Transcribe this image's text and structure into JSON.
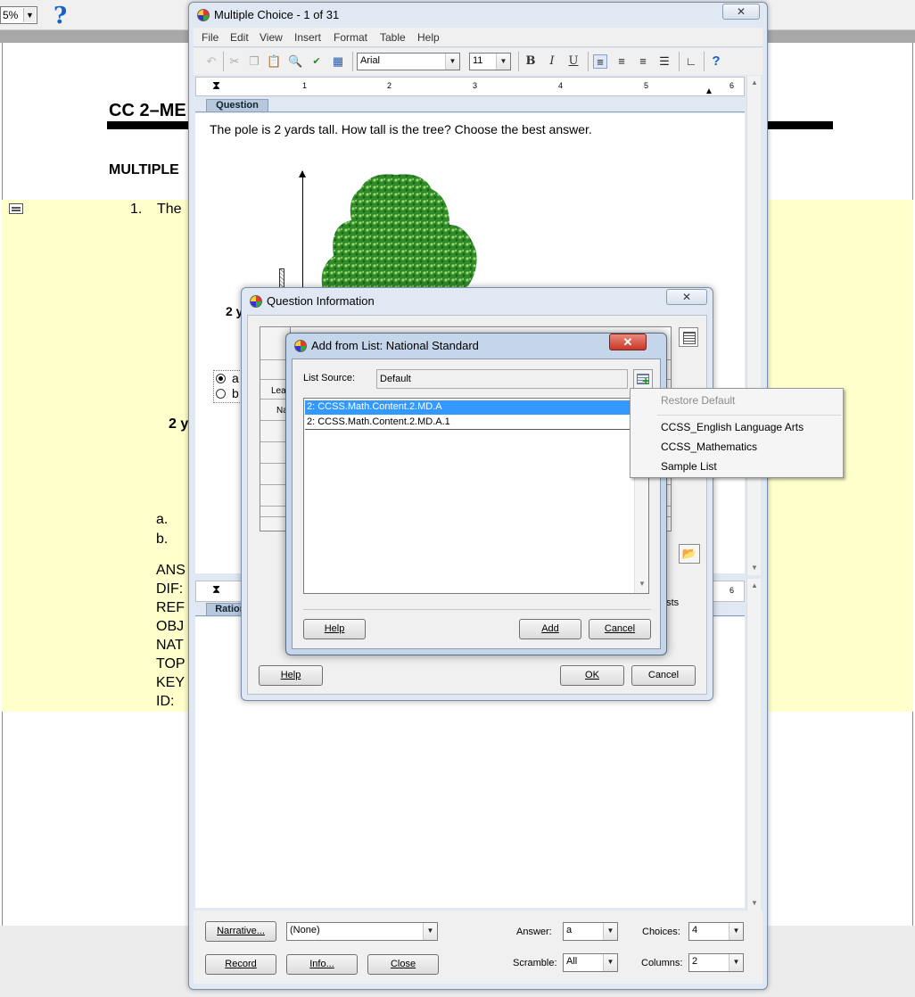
{
  "background_doc": {
    "zoom_value": "5%",
    "title": "CC 2–ME",
    "section_heading": "MULTIPLE",
    "question_number": "1.",
    "question_start": "The",
    "answer_lines": [
      "a.",
      "b."
    ],
    "field_lines": [
      "ANS",
      "DIF:",
      "REF",
      "OBJ",
      "NAT",
      "TOP",
      "KEY",
      "ID:"
    ]
  },
  "mc_window": {
    "title": "Multiple Choice - 1 of 31",
    "close_glyph": "✕",
    "menu": [
      "File",
      "Edit",
      "View",
      "Insert",
      "Format",
      "Table",
      "Help"
    ],
    "font_name": "Arial",
    "font_size": "11",
    "ruler_numbers": [
      "1",
      "2",
      "3",
      "4",
      "5",
      "6"
    ],
    "section_question": "Question",
    "section_rationale": "Rationale",
    "question_text": "The pole is 2 yards tall. How tall is the tree? Choose the best answer.",
    "pole_label": "2 y",
    "pole_label_2": "2 y",
    "choice_a": "a",
    "choice_b": "b",
    "bottom": {
      "narrative_button": "Narrative...",
      "narrative_value": "(None)",
      "answer_label": "Answer:",
      "answer_value": "a",
      "choices_label": "Choices:",
      "choices_value": "4",
      "record_button": "Record",
      "info_button": "Info...",
      "close_button": "Close",
      "scramble_label": "Scramble:",
      "scramble_value": "All",
      "columns_label": "Columns:",
      "columns_value": "2"
    }
  },
  "question_info": {
    "title": "Question Information",
    "close_glyph": "✕",
    "row_labels": [
      "Lea",
      "Na"
    ],
    "tests_text": "ests",
    "help_button": "Help",
    "ok_button": "OK",
    "cancel_button": "Cancel"
  },
  "add_from_list": {
    "title": "Add from List: National Standard",
    "close_glyph": "✕",
    "list_source_label": "List Source:",
    "list_source_value": "Default",
    "items": [
      "2: CCSS.Math.Content.2.MD.A",
      "2: CCSS.Math.Content.2.MD.A.1"
    ],
    "help_button": "Help",
    "add_button": "Add",
    "cancel_button": "Cancel"
  },
  "context_menu": {
    "items": [
      "Restore Default",
      "CCSS_English Language Arts",
      "CCSS_Mathematics",
      "Sample List"
    ]
  }
}
